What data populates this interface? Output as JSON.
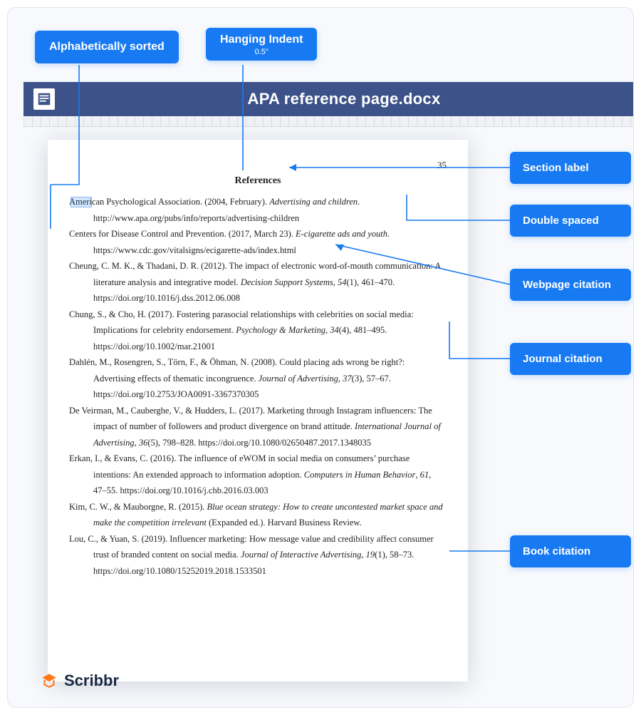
{
  "top_labels": {
    "alpha": "Alphabetically sorted",
    "indent": "Hanging Indent",
    "indent_sub": "0.5\""
  },
  "titlebar": {
    "filename": "APA reference page.docx"
  },
  "doc": {
    "page_number": "35",
    "heading": "References",
    "refs": [
      "American Psychological Association. (2004, February). <span class=\"it\">Advertising and children</span>. http://www.apa.org/pubs/info/reports/advertising-children",
      "Centers for Disease Control and Prevention. (2017, March 23). <span class=\"it\">E-cigarette ads and youth</span>. https://www.cdc.gov/vitalsigns/ecigarette-ads/index.html",
      "Cheung, C. M. K., & Thadani, D. R. (2012). The impact of electronic word-of-mouth communication: A literature analysis and integrative model. <span class=\"it\">Decision Support Systems</span>, <span class=\"it\">54</span>(1), 461–470. https://doi.org/10.1016/j.dss.2012.06.008",
      "Chung, S., & Cho, H. (2017). Fostering parasocial relationships with celebrities on social media: Implications for celebrity endorsement. <span class=\"it\">Psychology & Marketing</span>, <span class=\"it\">34</span>(4), 481–495. https://doi.org/10.1002/mar.21001",
      "Dahlén, M., Rosengren, S., Törn, F., & Öhman, N. (2008). Could placing ads wrong be right?: Advertising effects of thematic incongruence. <span class=\"it\">Journal of Advertising</span>, <span class=\"it\">37</span>(3), 57–67. https://doi.org/10.2753/JOA0091-3367370305",
      "De Veirman, M., Cauberghe, V., & Hudders, L. (2017). Marketing through Instagram influencers: The impact of number of followers and product divergence on brand attitude. <span class=\"it\">International Journal of Advertising</span>, <span class=\"it\">36</span>(5), 798–828. https://doi.org/10.1080/02650487.2017.1348035",
      "Erkan, I., & Evans, C. (2016). The influence of eWOM in social media on consumers’ purchase intentions: An extended approach to information adoption. <span class=\"it\">Computers in Human Behavior</span>, <span class=\"it\">61</span>, 47–55. https://doi.org/10.1016/j.chb.2016.03.003",
      "Kim, C. W., & Mauborgne, R. (2015). <span class=\"it\">Blue ocean strategy: How to create uncontested market space and make the competition irrelevant</span> (Expanded ed.). Harvard Business Review.",
      "Lou, C., & Yuan, S. (2019). Influencer marketing: How message value and credibility affect consumer trust of branded content on social media. <span class=\"it\">Journal of Interactive Advertising</span>, <span class=\"it\">19</span>(1), 58–73. https://doi.org/10.1080/15252019.2018.1533501"
    ]
  },
  "right_labels": {
    "section": "Section label",
    "spacing": "Double spaced",
    "webpage": "Webpage citation",
    "journal": "Journal citation",
    "book": "Book citation"
  },
  "brand": "Scribbr"
}
